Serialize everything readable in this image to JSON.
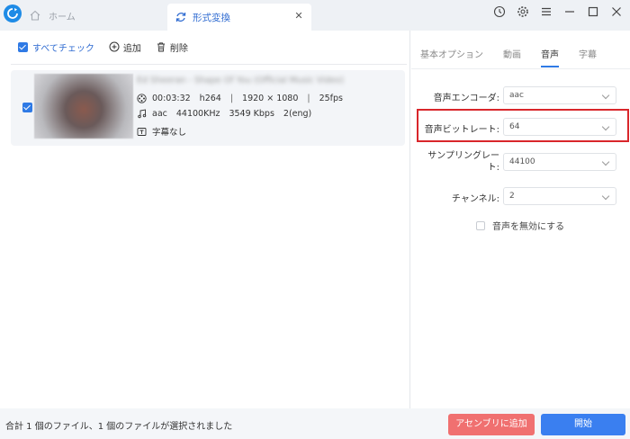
{
  "tabs": {
    "home_label": "ホーム",
    "active_label": "形式変換"
  },
  "toolbar": {
    "select_all_label": "すべてチェック",
    "add_label": "追加",
    "delete_label": "削除"
  },
  "file": {
    "title": "Ed Sheeran - Shape Of You (Official Music Video)",
    "duration": "00:03:32",
    "video_codec": "h264",
    "resolution": "1920 × 1080",
    "fps": "25fps",
    "audio_codec": "aac",
    "sample_rate": "44100KHz",
    "audio_bitrate": "3549 Kbps",
    "channels": "2(eng)",
    "subtitle": "字幕なし"
  },
  "options_tabs": [
    "基本オプション",
    "動画",
    "音声",
    "字幕"
  ],
  "audio": {
    "encoder_label": "音声エンコーダ:",
    "encoder_value": "aac",
    "bitrate_label": "音声ビットレート:",
    "bitrate_value": "64",
    "sampling_label_1": "サンプリングレー",
    "sampling_label_2": "ト:",
    "sampling_value": "44100",
    "channel_label": "チャンネル:",
    "channel_value": "2",
    "mute_label": "音声を無効にする"
  },
  "bottom": {
    "status": "合計 1 個のファイル、1 個のファイルが選択されました",
    "merge_label": "アセンブリに追加",
    "start_label": "開始"
  },
  "colors": {
    "accent": "#2f7ae5",
    "merge_button": "#f07070",
    "start_button": "#3a7ff0",
    "highlight": "#d9262b"
  }
}
